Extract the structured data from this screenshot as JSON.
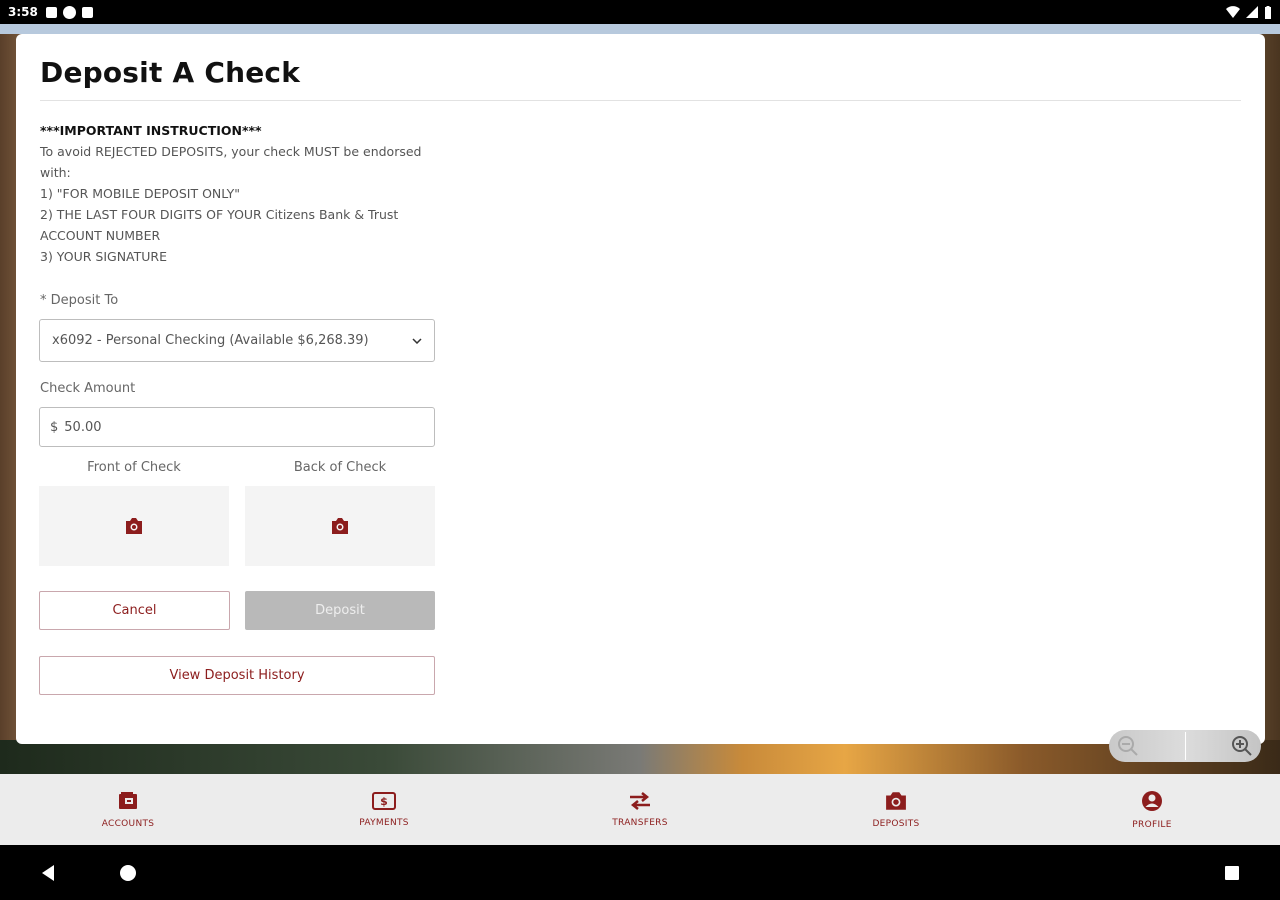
{
  "status_bar": {
    "time": "3:58"
  },
  "modal": {
    "title": "Deposit A Check",
    "instructions": {
      "heading": "***IMPORTANT INSTRUCTION***",
      "lines": [
        "To avoid REJECTED DEPOSITS, your check MUST be endorsed with:",
        "1) \"FOR MOBILE DEPOSIT ONLY\"",
        "2) THE LAST FOUR DIGITS OF YOUR Citizens Bank & Trust ACCOUNT NUMBER",
        "3) YOUR SIGNATURE"
      ]
    },
    "deposit_to": {
      "label": "* Deposit To",
      "selected": "x6092 - Personal Checking (Available $6,268.39)"
    },
    "check_amount": {
      "label": "Check Amount",
      "currency": "$",
      "value": "50.00"
    },
    "front_label": "Front of Check",
    "back_label": "Back of Check",
    "cancel_label": "Cancel",
    "deposit_label": "Deposit",
    "history_label": "View Deposit History"
  },
  "bottom_nav": [
    {
      "label": "ACCOUNTS",
      "icon": "wallet-icon"
    },
    {
      "label": "PAYMENTS",
      "icon": "dollar-icon"
    },
    {
      "label": "TRANSFERS",
      "icon": "swap-arrows-icon"
    },
    {
      "label": "DEPOSITS",
      "icon": "camera-icon"
    },
    {
      "label": "PROFILE",
      "icon": "person-icon"
    }
  ],
  "colors": {
    "brand": "#8c1d1d",
    "disabled_button": "#b9b9b9",
    "nav_background": "#ececec"
  }
}
